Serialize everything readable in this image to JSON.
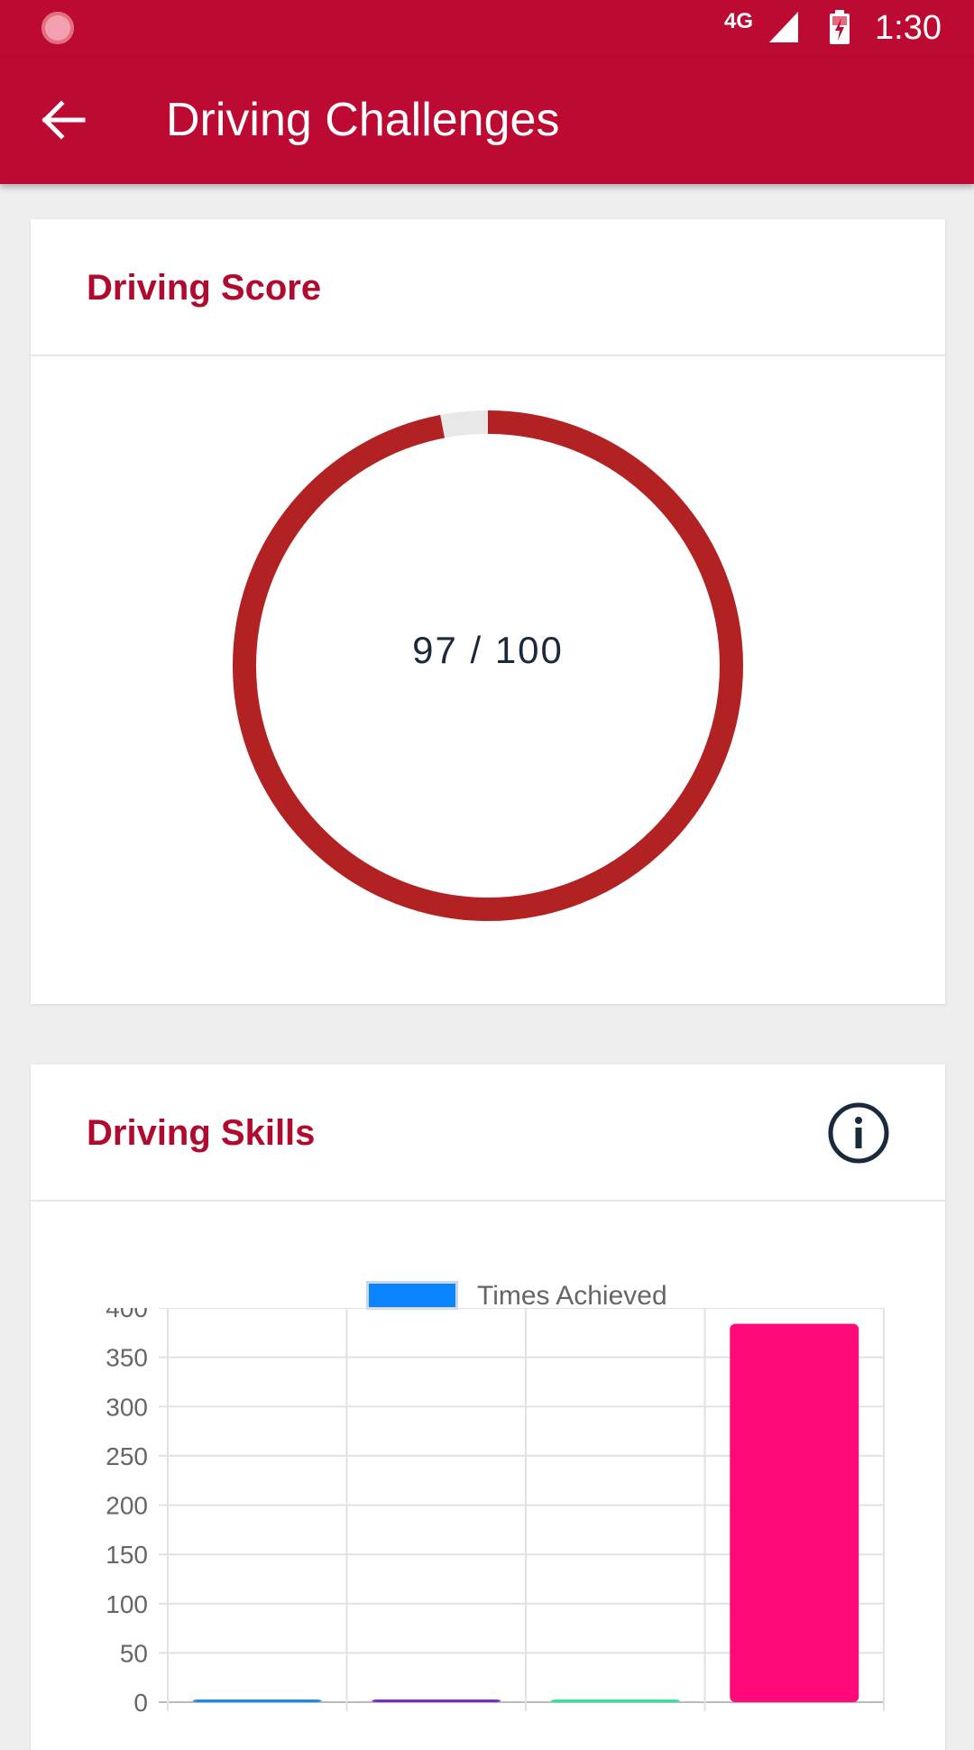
{
  "status_bar": {
    "network": "4G",
    "time": "1:30"
  },
  "app_bar": {
    "title": "Driving Challenges"
  },
  "score_card": {
    "title": "Driving Score",
    "score": 97,
    "max": 100,
    "score_text": "97 / 100",
    "colors": {
      "fill": "#b22222",
      "remainder": "#e8e8e8"
    }
  },
  "skills_card": {
    "title": "Driving Skills",
    "legend_label": "Times Achieved"
  },
  "chart_data": {
    "type": "bar",
    "categories": [
      "",
      "",
      "",
      ""
    ],
    "series": [
      {
        "name": "Times Achieved",
        "values": [
          0,
          0,
          0,
          384
        ],
        "colors": [
          "#1e88e5",
          "#7b2cbf",
          "#2ee59d",
          "#ff0a78"
        ]
      }
    ],
    "ylim": [
      0,
      400
    ],
    "yticks": [
      0,
      50,
      100,
      150,
      200,
      250,
      300,
      350,
      400
    ],
    "grid": true,
    "legend": "top-center"
  }
}
